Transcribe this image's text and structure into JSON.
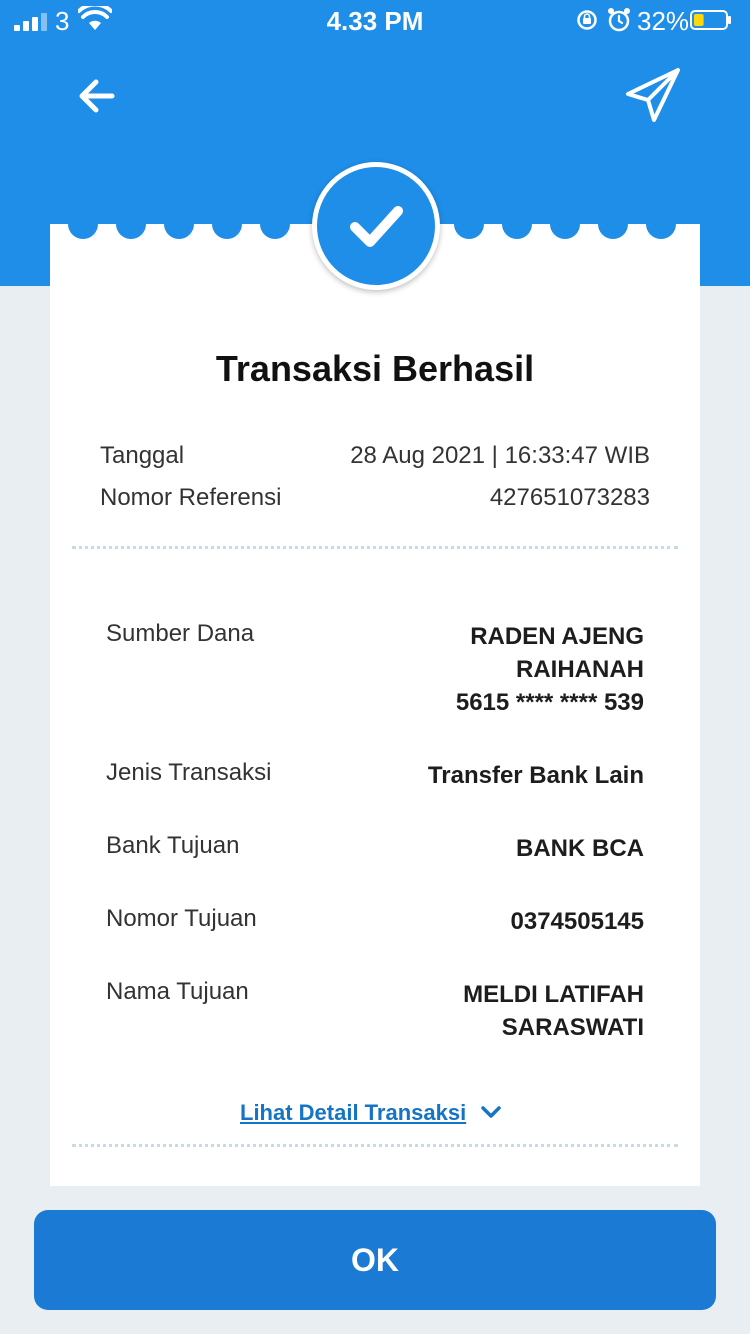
{
  "status_bar": {
    "carrier": "3",
    "time": "4.33 PM",
    "battery": "32%",
    "battery_level": 0.32
  },
  "header": {
    "back_icon": "arrow-left-icon",
    "share_icon": "paper-plane-icon",
    "color": "#1f8ee8"
  },
  "receipt": {
    "status_icon": "check-icon",
    "title": "Transaksi Berhasil",
    "meta": [
      {
        "label": "Tanggal",
        "value": "28 Aug 2021 | 16:33:47 WIB"
      },
      {
        "label": "Nomor Referensi",
        "value": "427651073283"
      }
    ],
    "details": [
      {
        "label": "Sumber Dana",
        "value_lines": [
          "RADEN AJENG",
          "RAIHANAH",
          "5615 **** **** 539"
        ]
      },
      {
        "label": "Jenis Transaksi",
        "value_lines": [
          "Transfer Bank Lain"
        ]
      },
      {
        "label": "Bank Tujuan",
        "value_lines": [
          "BANK BCA"
        ]
      },
      {
        "label": "Nomor Tujuan",
        "value_lines": [
          "0374505145"
        ]
      },
      {
        "label": "Nama Tujuan",
        "value_lines": [
          "MELDI LATIFAH",
          "SARASWATI"
        ]
      }
    ],
    "detail_link": "Lihat Detail Transaksi"
  },
  "ok_button": "OK",
  "colors": {
    "primary": "#1f8ee8",
    "button": "#1a7ad4",
    "link": "#1674c5",
    "background": "#e9eef3"
  }
}
